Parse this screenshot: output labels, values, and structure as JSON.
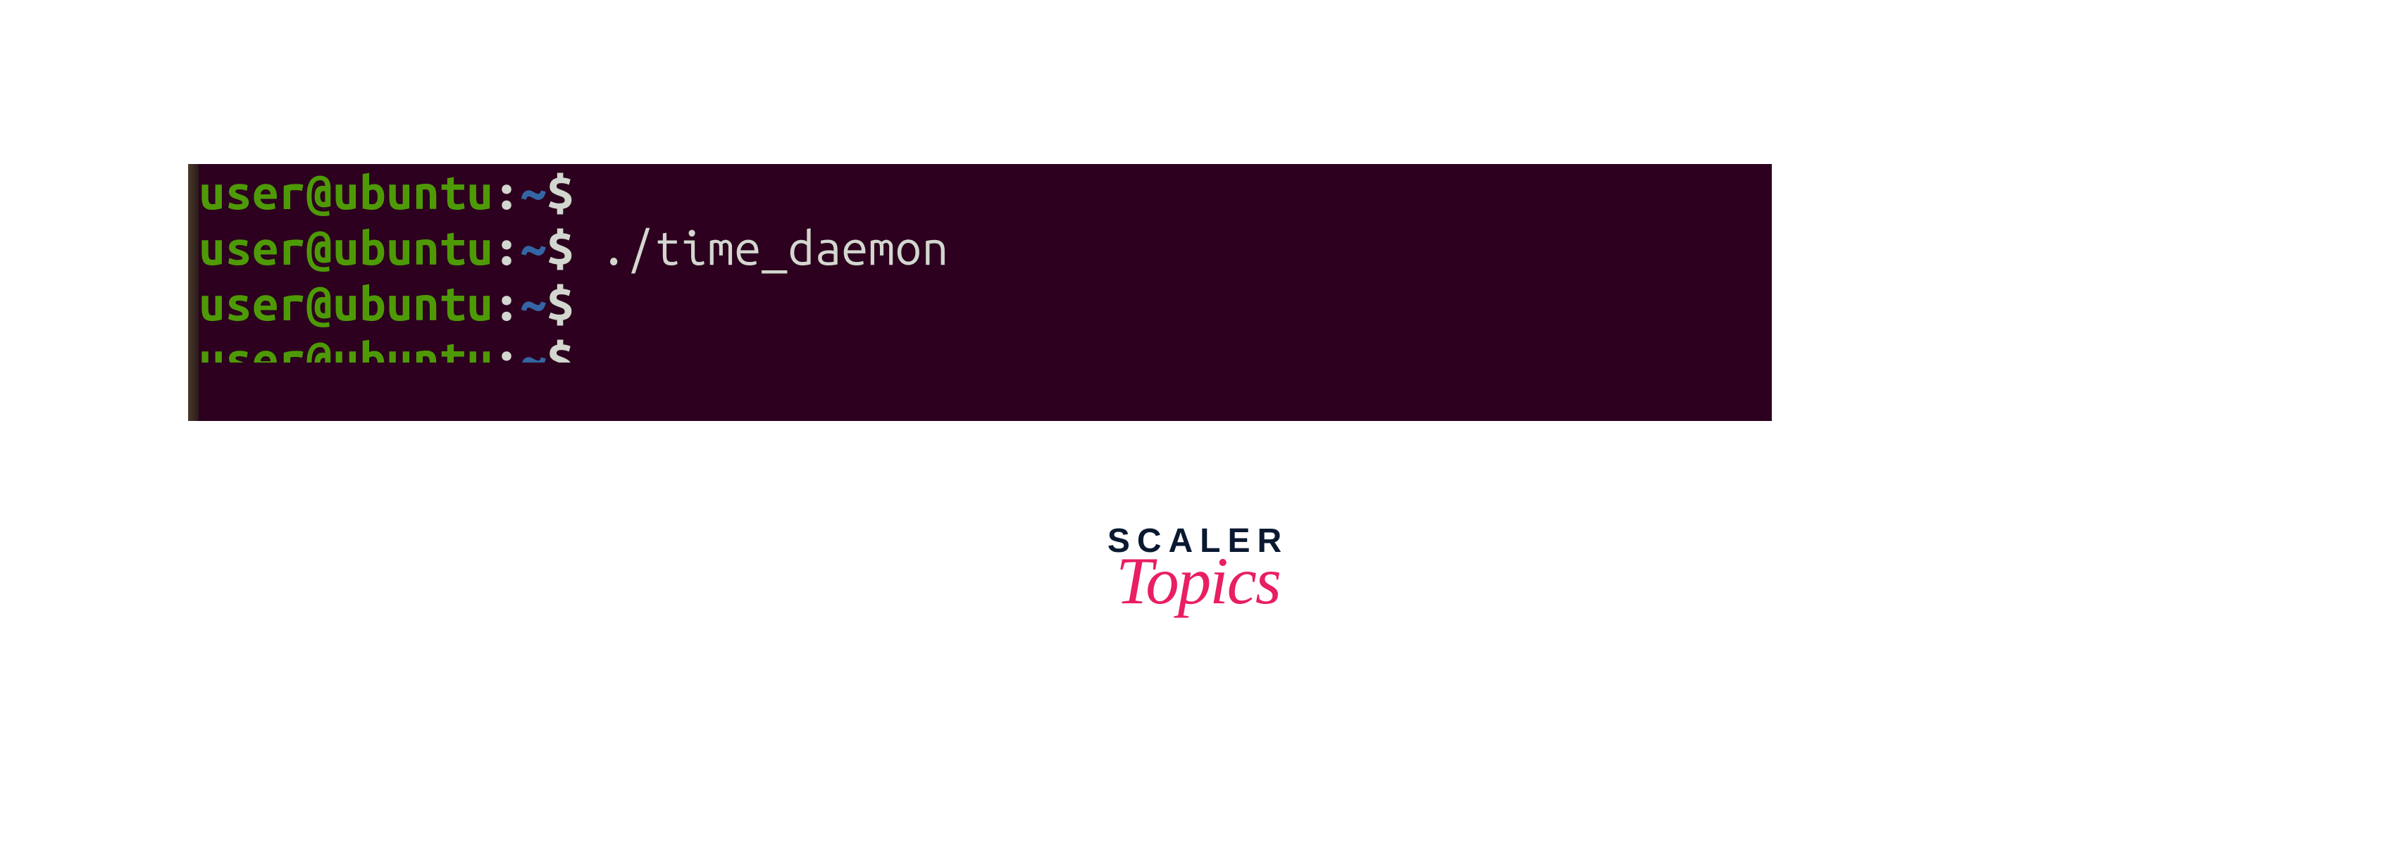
{
  "terminal": {
    "lines": [
      {
        "user": "user@ubuntu",
        "colon": ":",
        "path": "~",
        "dollar": "$",
        "command": ""
      },
      {
        "user": "user@ubuntu",
        "colon": ":",
        "path": "~",
        "dollar": "$",
        "command": " ./time_daemon"
      },
      {
        "user": "user@ubuntu",
        "colon": ":",
        "path": "~",
        "dollar": "$",
        "command": ""
      },
      {
        "user": "user@ubuntu",
        "colon": ":",
        "path": "~",
        "dollar": "$",
        "command": ""
      }
    ]
  },
  "logo": {
    "line1": "SCALER",
    "line2": "Topics"
  }
}
